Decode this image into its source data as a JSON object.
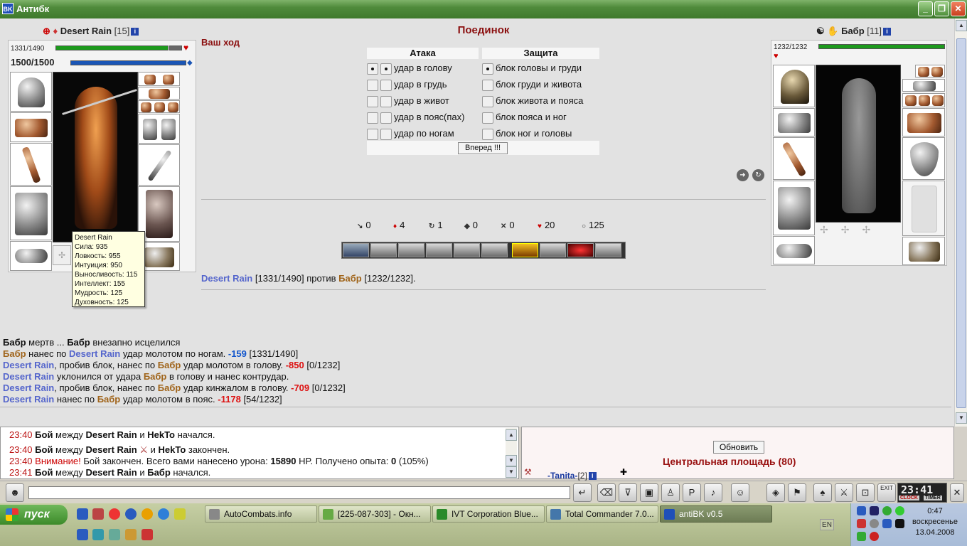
{
  "window": {
    "title": "Антибк",
    "app_icon": "BK"
  },
  "left_player": {
    "name": "Desert Rain",
    "level": "[15]",
    "info": "i",
    "hp": "1331/1490",
    "hp_fraction": 0.893,
    "mana": "1500/1500",
    "mana_fraction": 1.0,
    "tooltip": {
      "name": "Desert Rain",
      "lines": [
        "Сила: 935",
        "Ловкость: 955",
        "Интуиция: 950",
        "Выносливость: 115",
        "Интеллект: 155",
        "Мудрость: 125",
        "Духовность: 125"
      ]
    }
  },
  "right_player": {
    "name": "Бабр",
    "level": "[11]",
    "info": "i",
    "hp": "1232/1232",
    "hp_fraction": 1.0
  },
  "battle": {
    "title": "Поединок",
    "your_turn": "Ваш ход",
    "attack_header": "Атака",
    "defense_header": "Защита",
    "attacks": [
      "удар в голову",
      "удар в грудь",
      "удар в живот",
      "удар в пояс(пах)",
      "удар по ногам"
    ],
    "blocks": [
      "блок головы и груди",
      "блок груди и живота",
      "блок живота и пояса",
      "блок пояса и ног",
      "блок ног и головы"
    ],
    "go_button": "Вперед !!!",
    "stats": [
      {
        "icon": "arrow-icon",
        "glyph": "↘",
        "value": "0"
      },
      {
        "icon": "blood-drop-icon",
        "glyph": "♦",
        "value": "4"
      },
      {
        "icon": "swirl-icon",
        "glyph": "↻",
        "value": "1"
      },
      {
        "icon": "shield-icon",
        "glyph": "◆",
        "value": "0"
      },
      {
        "icon": "crossed-swords-icon",
        "glyph": "✕",
        "value": "0"
      },
      {
        "icon": "heart-icon",
        "glyph": "♥",
        "value": "20"
      },
      {
        "icon": "ring-icon",
        "glyph": "○",
        "value": "125"
      }
    ],
    "versus": {
      "p1": "Desert Rain",
      "p1_hp": "[1331/1490]",
      "word": "против",
      "p2": "Бабр",
      "p2_hp": "[1232/1232]."
    }
  },
  "combat_log": {
    "l1": {
      "a": "Бабр",
      "b": " мертв ... ",
      "c": "Бабр",
      "d": " внезапно исцелился"
    },
    "l2": {
      "a": "Бабр",
      "b": " нанес по ",
      "c": "Desert Rain",
      "d": " удар молотом по ногам. ",
      "dmg": "-159",
      "hp": " [1331/1490]"
    },
    "l3": {
      "a": "Desert Rain",
      "b": ", пробив блок, нанес по ",
      "c": "Бабр",
      "d": " удар молотом в голову. ",
      "dmg": "-850",
      "hp": " [0/1232]"
    },
    "l4": {
      "a": "Desert Rain",
      "b": " уклонился от удара ",
      "c": "Бабр",
      "d": " в голову и нанес контрудар."
    },
    "l5": {
      "a": "Desert Rain",
      "b": ", пробив блок, нанес по ",
      "c": "Бабр",
      "d": " удар кинжалом в голову. ",
      "dmg": "-709",
      "hp": " [0/1232]"
    },
    "l6": {
      "a": "Desert Rain",
      "b": " нанес по ",
      "c": "Бабр",
      "d": " удар молотом в пояс. ",
      "dmg": "-1178",
      "hp": " [54/1232]"
    }
  },
  "chat": {
    "c1": {
      "time": "23:40",
      "t1": " Бой",
      "t2": " между ",
      "n1": "Desert Rain",
      "t3": " и ",
      "n2": "HekTo",
      "t4": " начался."
    },
    "c2": {
      "time": "23:40",
      "t1": " Бой",
      "t2": " между ",
      "n1": "Desert Rain",
      "t3": " и ",
      "n2": "HekTo",
      "t4": " закончен."
    },
    "c3": {
      "time": "23:40",
      "warn": " Внимание!",
      "t1": " Бой закончен. Всего вами нанесено урона: ",
      "dmg": "15890",
      "t2": " HP. Получено опыта: ",
      "exp": "0",
      "t3": " (105%)"
    },
    "c4": {
      "time": "23:41",
      "t1": " Бой",
      "t2": " между ",
      "n1": "Desert Rain",
      "t3": " и ",
      "n2": "Бабр",
      "t4": " начался."
    }
  },
  "right_panel": {
    "refresh": "Обновить",
    "location": "Центральная площадь (80)",
    "user": "-Tanita-",
    "user_level": "[2]"
  },
  "toolbar": {
    "chat_input_value": "",
    "clock": "23:41",
    "clock_label": "CLOCK",
    "timer_label": "TIMER",
    "exit_label": "EXIT"
  },
  "taskbar": {
    "start": "пуск",
    "tasks": [
      "AutoCombats.info",
      "[225-087-303] - Окн...",
      "IVT Corporation Blue...",
      "Total Commander 7.0...",
      "antiBK v0.5"
    ],
    "lang": "EN",
    "time": "0:47",
    "day": "воскресенье",
    "date": "13.04.2008"
  }
}
